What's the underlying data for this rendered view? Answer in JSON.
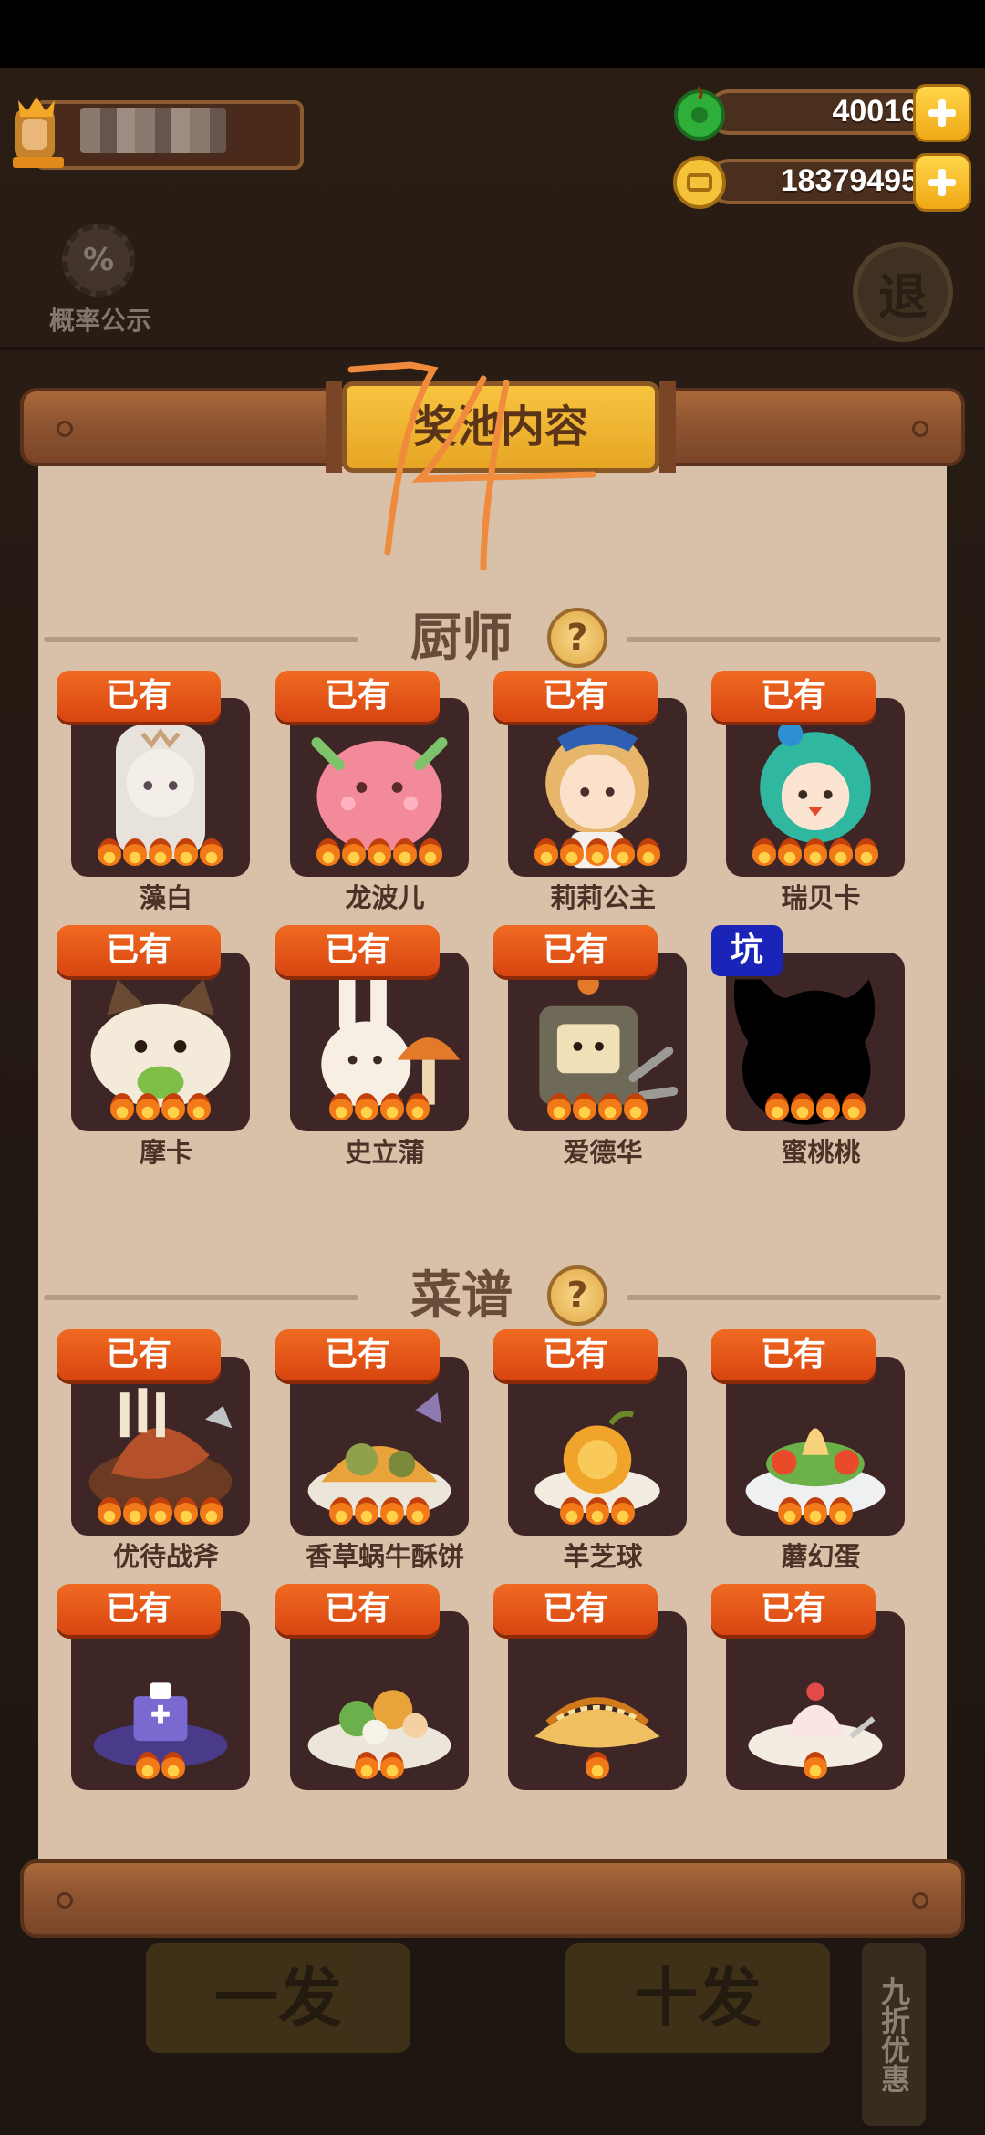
{
  "hud": {
    "player_name": "",
    "jade": "40016",
    "coins": "18379495",
    "probability_label": "概率公示",
    "exit_label": "退"
  },
  "panel": {
    "title": "奖池内容",
    "scribble": "74",
    "chefs_title": "厨师",
    "recipes_title": "菜谱",
    "help_glyph": "?"
  },
  "chefs": [
    {
      "name": "藻白",
      "badge": "已有",
      "stars": 5,
      "art": "chef-white"
    },
    {
      "name": "龙波儿",
      "badge": "已有",
      "stars": 5,
      "art": "chef-pink"
    },
    {
      "name": "莉莉公主",
      "badge": "已有",
      "stars": 5,
      "art": "chef-girl"
    },
    {
      "name": "瑞贝卡",
      "badge": "已有",
      "stars": 5,
      "art": "chef-teal"
    },
    {
      "name": "摩卡",
      "badge": "已有",
      "stars": 4,
      "art": "chef-cat"
    },
    {
      "name": "史立蒲",
      "badge": "已有",
      "stars": 4,
      "art": "chef-bunny"
    },
    {
      "name": "爱德华",
      "badge": "已有",
      "stars": 4,
      "art": "chef-robot"
    },
    {
      "name": "蜜桃桃",
      "badge": "坑",
      "stars": 4,
      "art": "chef-shadow"
    }
  ],
  "recipes": [
    {
      "name": "优待战斧",
      "badge": "已有",
      "stars": 5,
      "art": "dish-steak"
    },
    {
      "name": "香草蜗牛酥饼",
      "badge": "已有",
      "stars": 4,
      "art": "dish-pie"
    },
    {
      "name": "羊芝球",
      "badge": "已有",
      "stars": 3,
      "art": "dish-ball"
    },
    {
      "name": "蘑幻蛋",
      "badge": "已有",
      "stars": 3,
      "art": "dish-egg"
    },
    {
      "name": "",
      "badge": "已有",
      "stars": 2,
      "art": "dish-cake"
    },
    {
      "name": "",
      "badge": "已有",
      "stars": 2,
      "art": "dish-salad"
    },
    {
      "name": "",
      "badge": "已有",
      "stars": 1,
      "art": "dish-bread"
    },
    {
      "name": "",
      "badge": "已有",
      "stars": 1,
      "art": "dish-pudding"
    }
  ],
  "footer": {
    "single_draw": "一发",
    "ten_draw": "十发",
    "discount": "九折优惠"
  },
  "colors": {
    "badge_owned": "#e2541a",
    "badge_pit": "#1a24b8",
    "paper": "#d8c1a8",
    "card": "#3e2626"
  }
}
